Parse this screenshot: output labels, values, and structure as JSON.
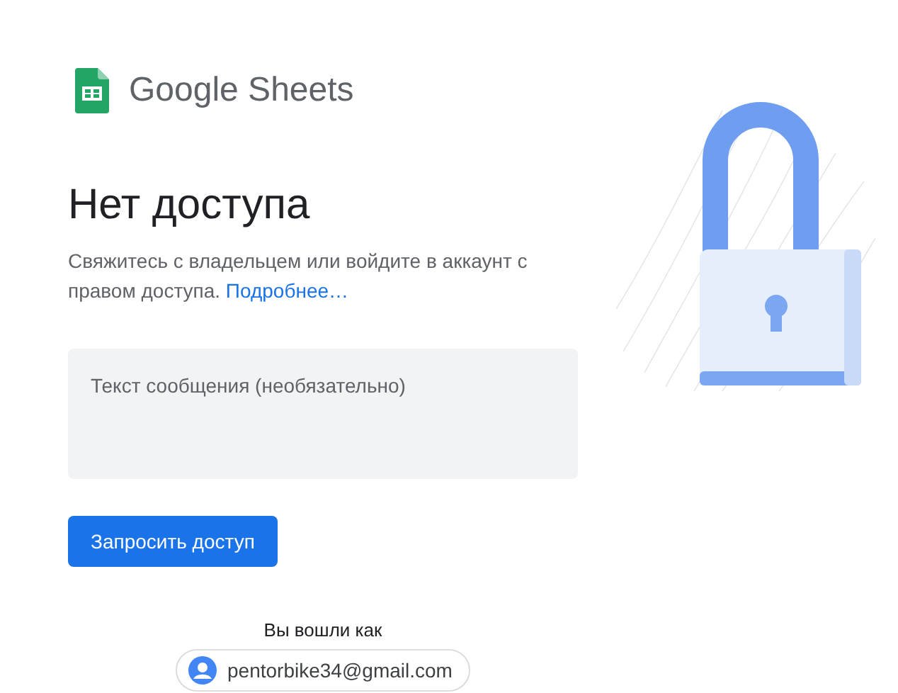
{
  "logo": {
    "text": "Google Sheets"
  },
  "heading": "Нет доступа",
  "message": {
    "text": "Свяжитесь с владельцем или войдите в аккаунт с правом доступа.",
    "link": "Подробнее…"
  },
  "message_field": {
    "placeholder": "Текст сообщения (необязательно)"
  },
  "request_button": "Запросить доступ",
  "signed_in": {
    "label": "Вы вошли как",
    "account": "pentorbike34@gmail.com"
  }
}
